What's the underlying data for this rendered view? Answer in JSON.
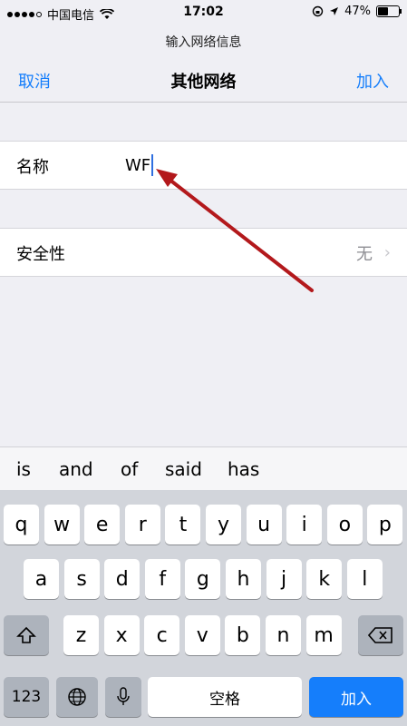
{
  "status_bar": {
    "carrier": "中国电信",
    "time": "17:02",
    "battery_percent": "47%",
    "battery_level": 0.47,
    "icons": [
      "signal-dots-icon",
      "wifi-icon",
      "orientation-lock-icon",
      "location-arrow-icon",
      "battery-icon"
    ]
  },
  "prompt": "输入网络信息",
  "nav": {
    "cancel": "取消",
    "title": "其他网络",
    "join": "加入"
  },
  "form": {
    "name_label": "名称",
    "name_value": "WF",
    "security_label": "安全性",
    "security_value": "无",
    "chevron": "›"
  },
  "suggestions": [
    "is",
    "and",
    "of",
    "said",
    "has"
  ],
  "keyboard": {
    "row1": [
      "q",
      "w",
      "e",
      "r",
      "t",
      "y",
      "u",
      "i",
      "o",
      "p"
    ],
    "row2": [
      "a",
      "s",
      "d",
      "f",
      "g",
      "h",
      "j",
      "k",
      "l"
    ],
    "row3": [
      "z",
      "x",
      "c",
      "v",
      "b",
      "n",
      "m"
    ],
    "numbers_key": "123",
    "space_key": "空格",
    "join_key": "加入",
    "shift_icon": "shift-icon",
    "delete_icon": "delete-icon",
    "globe_icon": "globe-icon",
    "mic_icon": "microphone-icon"
  },
  "colors": {
    "accent": "#157efb",
    "annotation_arrow": "#b3191c",
    "caret": "#2f6fe0"
  }
}
